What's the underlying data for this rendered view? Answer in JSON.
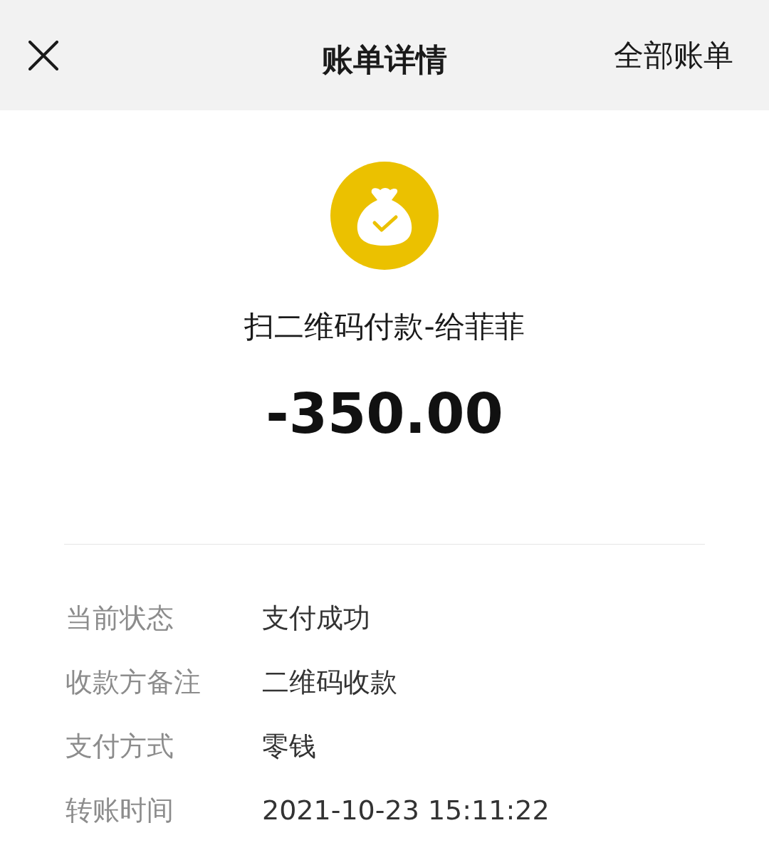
{
  "header": {
    "title": "账单详情",
    "action": "全部账单"
  },
  "payment": {
    "title": "扫二维码付款-给菲菲",
    "amount": "-350.00"
  },
  "details": [
    {
      "label": "当前状态",
      "value": "支付成功"
    },
    {
      "label": "收款方备注",
      "value": "二维码收款"
    },
    {
      "label": "支付方式",
      "value": "零钱"
    },
    {
      "label": "转账时间",
      "value": "2021-10-23 15:11:22"
    }
  ]
}
